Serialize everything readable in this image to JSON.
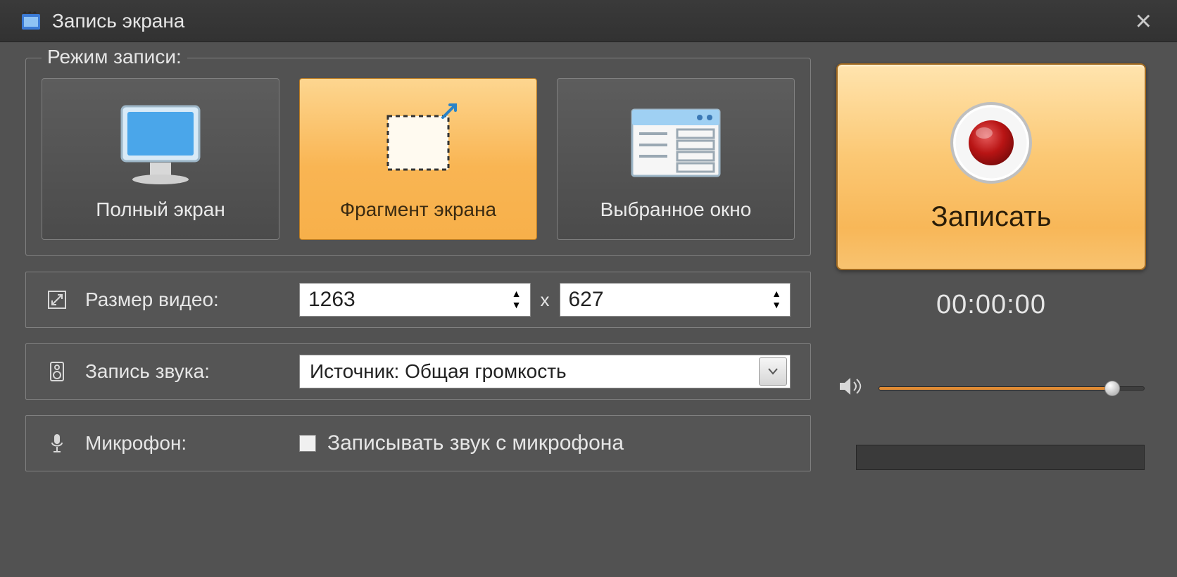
{
  "window": {
    "title": "Запись экрана"
  },
  "mode": {
    "legend": "Режим записи:",
    "buttons": {
      "full": "Полный экран",
      "fragment": "Фрагмент экрана",
      "window": "Выбранное окно"
    },
    "selected": "fragment"
  },
  "size": {
    "label": "Размер видео:",
    "width": "1263",
    "height": "627",
    "separator": "x"
  },
  "audio": {
    "label": "Запись звука:",
    "source": "Источник: Общая громкость"
  },
  "mic": {
    "label": "Микрофон:",
    "checkbox_label": "Записывать звук с микрофона",
    "checked": false
  },
  "record": {
    "button_label": "Записать",
    "timer": "00:00:00"
  },
  "volume": {
    "value_percent": 88
  }
}
